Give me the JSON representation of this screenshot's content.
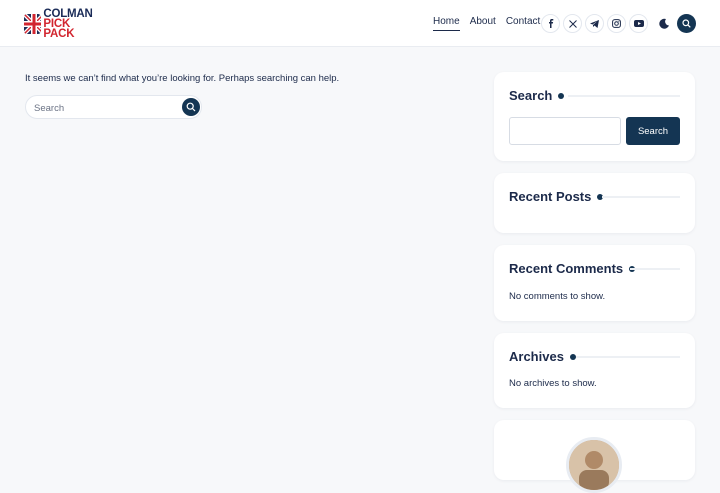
{
  "logo": {
    "line1": "COLMAN",
    "line2": "PICK PACK"
  },
  "nav": {
    "items": [
      {
        "label": "Home",
        "active": true
      },
      {
        "label": "About",
        "active": false
      },
      {
        "label": "Contact",
        "active": false
      }
    ]
  },
  "social_icons": [
    "facebook-icon",
    "x-icon",
    "telegram-icon",
    "instagram-icon",
    "youtube-icon"
  ],
  "theme_toggle_icon": "moon-icon",
  "main": {
    "message": "It seems we can’t find what you’re looking for. Perhaps searching can help.",
    "search_placeholder": "Search"
  },
  "sidebar": {
    "search": {
      "title": "Search",
      "button_label": "Search"
    },
    "recent_posts": {
      "title": "Recent Posts"
    },
    "recent_comments": {
      "title": "Recent Comments",
      "empty_text": "No comments to show."
    },
    "archives": {
      "title": "Archives",
      "empty_text": "No archives to show."
    }
  },
  "colors": {
    "accent": "#143553",
    "text": "#1c2a4a",
    "background": "#f7f8fa"
  }
}
